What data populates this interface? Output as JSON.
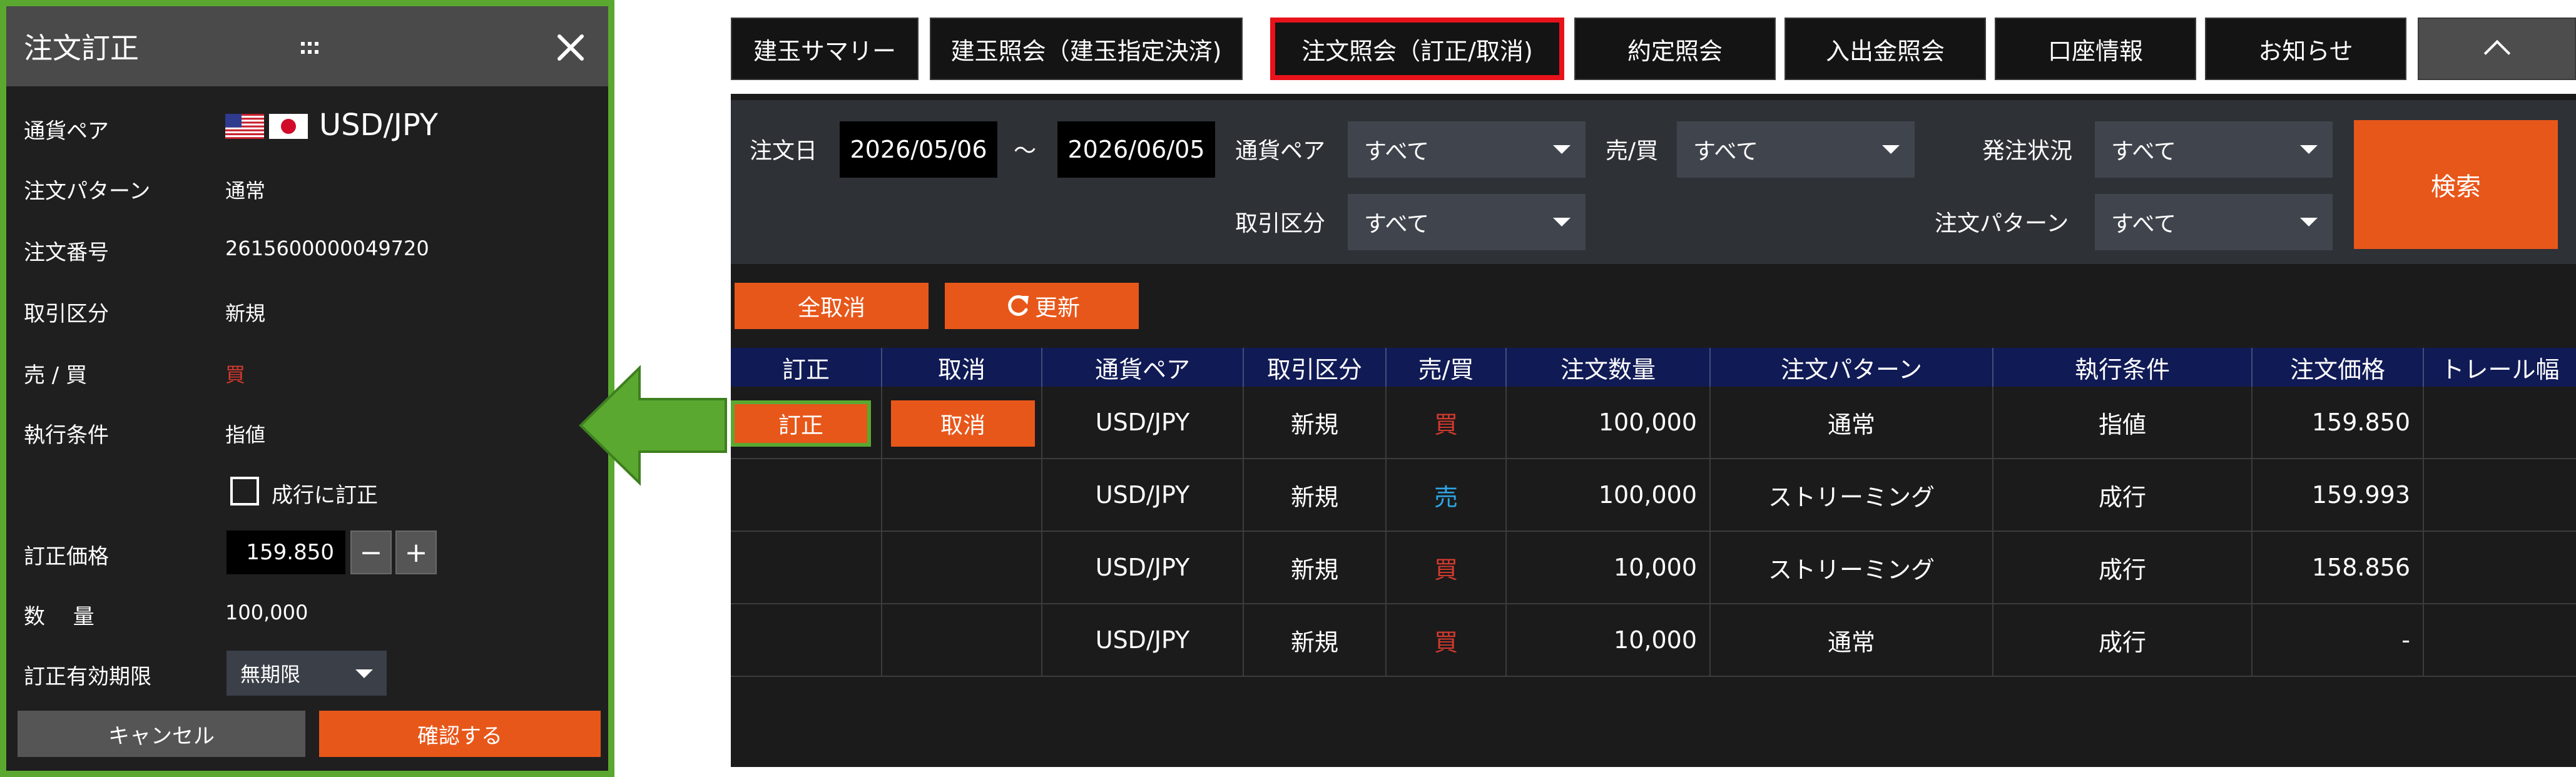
{
  "panel": {
    "title": "注文訂正",
    "fields": {
      "pair_label": "通貨ペア",
      "pair_value": "USD/JPY",
      "pattern_label": "注文パターン",
      "pattern_value": "通常",
      "order_no_label": "注文番号",
      "order_no_value": "2615600000049720",
      "trade_type_label": "取引区分",
      "trade_type_value": "新規",
      "side_label": "売 / 買",
      "side_value": "買",
      "exec_label": "執行条件",
      "exec_value": "指値",
      "market_checkbox_label": "成行に訂正",
      "price_label": "訂正価格",
      "price_value": "159.850",
      "minus": "−",
      "plus": "+",
      "qty_label": "数　 量",
      "qty_value": "100,000",
      "expiry_label": "訂正有効期限",
      "expiry_value": "無期限"
    },
    "cancel_label": "キャンセル",
    "confirm_label": "確認する"
  },
  "tabs": [
    {
      "label": "建玉サマリー"
    },
    {
      "label": "建玉照会（建玉指定決済)"
    },
    {
      "label": "注文照会（訂正/取消)"
    },
    {
      "label": "約定照会"
    },
    {
      "label": "入出金照会"
    },
    {
      "label": "口座情報"
    },
    {
      "label": "お知らせ"
    }
  ],
  "filter": {
    "date_label": "注文日",
    "date_from": "2026/05/06",
    "tilde": "～",
    "date_to": "2026/06/05",
    "pair_label": "通貨ペア",
    "pair_value": "すべて",
    "side_label": "売/買",
    "side_value": "すべて",
    "status_label": "発注状況",
    "status_value": "すべて",
    "trade_type_label": "取引区分",
    "trade_type_value": "すべて",
    "pattern_label": "注文パターン",
    "pattern_value": "すべて",
    "search_label": "検索"
  },
  "actions": {
    "cancel_all": "全取消",
    "refresh": "更新"
  },
  "table": {
    "headers": [
      "訂正",
      "取消",
      "通貨ペア",
      "取引区分",
      "売/買",
      "注文数量",
      "注文パターン",
      "執行条件",
      "注文価格",
      "トレール幅"
    ],
    "edit_button": "訂正",
    "cancel_button": "取消",
    "rows": [
      {
        "pair": "USD/JPY",
        "type": "新規",
        "side": "買",
        "qty": "100,000",
        "pattern": "通常",
        "exec": "指値",
        "price": "159.850"
      },
      {
        "pair": "USD/JPY",
        "type": "新規",
        "side": "売",
        "qty": "100,000",
        "pattern": "ストリーミング",
        "exec": "成行",
        "price": "159.993"
      },
      {
        "pair": "USD/JPY",
        "type": "新規",
        "side": "買",
        "qty": "10,000",
        "pattern": "ストリーミング",
        "exec": "成行",
        "price": "158.856"
      },
      {
        "pair": "USD/JPY",
        "type": "新規",
        "side": "買",
        "qty": "10,000",
        "pattern": "通常",
        "exec": "成行",
        "price": "-"
      }
    ]
  },
  "colors": {
    "accent": "#e8571a",
    "highlight_green": "#5aa830",
    "active_tab_border": "#e8121a",
    "buy": "#d23a2e",
    "sell": "#2ea6e6",
    "table_header": "#101a55"
  },
  "icons": [
    "grip-icon",
    "close-icon",
    "us-flag-icon",
    "jp-flag-icon",
    "refresh-icon",
    "chevron-up-icon",
    "caret-down-icon",
    "arrow-left-icon"
  ]
}
